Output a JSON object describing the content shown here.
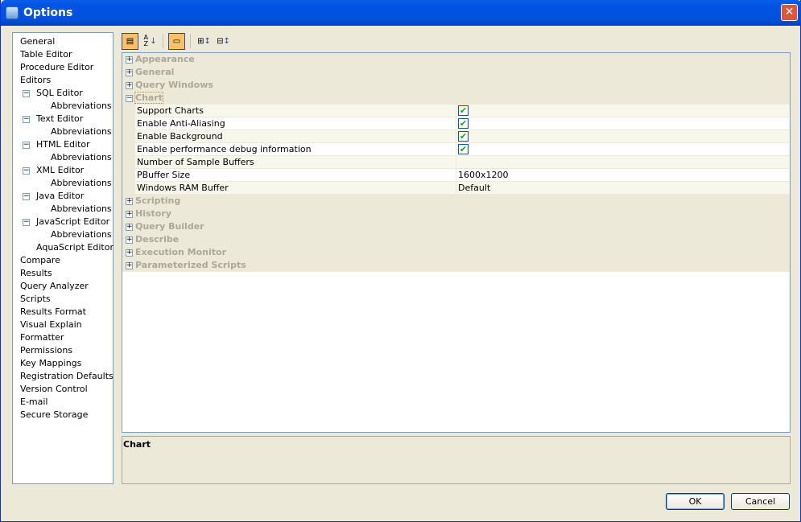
{
  "window": {
    "title": "Options",
    "close": "✕"
  },
  "tree": [
    {
      "label": "General",
      "level": 0
    },
    {
      "label": "Table Editor",
      "level": 0
    },
    {
      "label": "Procedure Editor",
      "level": 0
    },
    {
      "label": "Editors",
      "level": 0
    },
    {
      "label": "SQL Editor",
      "level": 1,
      "exp": "−"
    },
    {
      "label": "Abbreviations",
      "level": 2
    },
    {
      "label": "Text Editor",
      "level": 1,
      "exp": "−"
    },
    {
      "label": "Abbreviations",
      "level": 2
    },
    {
      "label": "HTML Editor",
      "level": 1,
      "exp": "−"
    },
    {
      "label": "Abbreviations",
      "level": 2
    },
    {
      "label": "XML Editor",
      "level": 1,
      "exp": "−"
    },
    {
      "label": "Abbreviations",
      "level": 2
    },
    {
      "label": "Java Editor",
      "level": 1,
      "exp": "−"
    },
    {
      "label": "Abbreviations",
      "level": 2
    },
    {
      "label": "JavaScript Editor",
      "level": 1,
      "exp": "−"
    },
    {
      "label": "Abbreviations",
      "level": 2
    },
    {
      "label": "AquaScript Editor",
      "level": 1
    },
    {
      "label": "Compare",
      "level": 0
    },
    {
      "label": "Results",
      "level": 0
    },
    {
      "label": "Query Analyzer",
      "level": 0
    },
    {
      "label": "Scripts",
      "level": 0
    },
    {
      "label": "Results Format",
      "level": 0
    },
    {
      "label": "Visual Explain",
      "level": 0
    },
    {
      "label": "Formatter",
      "level": 0
    },
    {
      "label": "Permissions",
      "level": 0
    },
    {
      "label": "Key Mappings",
      "level": 0
    },
    {
      "label": "Registration Defaults",
      "level": 0
    },
    {
      "label": "Version Control",
      "level": 0
    },
    {
      "label": "E-mail",
      "level": 0
    },
    {
      "label": "Secure Storage",
      "level": 0
    }
  ],
  "toolbar": {
    "categorized": "categorized-icon",
    "alpha": "A Z",
    "desc": "description-icon",
    "expand": "expand-all-icon",
    "collapse": "collapse-all-icon"
  },
  "categories_before": [
    "Appearance",
    "General",
    "Query Windows"
  ],
  "open_category": "Chart",
  "properties": [
    {
      "name": "Support Charts",
      "checked": true,
      "value": ""
    },
    {
      "name": "Enable Anti-Aliasing",
      "checked": true,
      "value": ""
    },
    {
      "name": "Enable Background",
      "checked": true,
      "value": ""
    },
    {
      "name": "Enable performance debug information",
      "checked": true,
      "value": ""
    },
    {
      "name": "Number of Sample Buffers",
      "value": ""
    },
    {
      "name": "PBuffer Size",
      "value": "1600x1200"
    },
    {
      "name": "Windows RAM Buffer",
      "value": "Default"
    }
  ],
  "categories_after": [
    "Scripting",
    "History",
    "Query Builder",
    "Describe",
    "Execution Monitor",
    "Parameterized Scripts"
  ],
  "description": {
    "title": "Chart"
  },
  "buttons": {
    "ok": "OK",
    "cancel": "Cancel"
  },
  "check": "✔"
}
